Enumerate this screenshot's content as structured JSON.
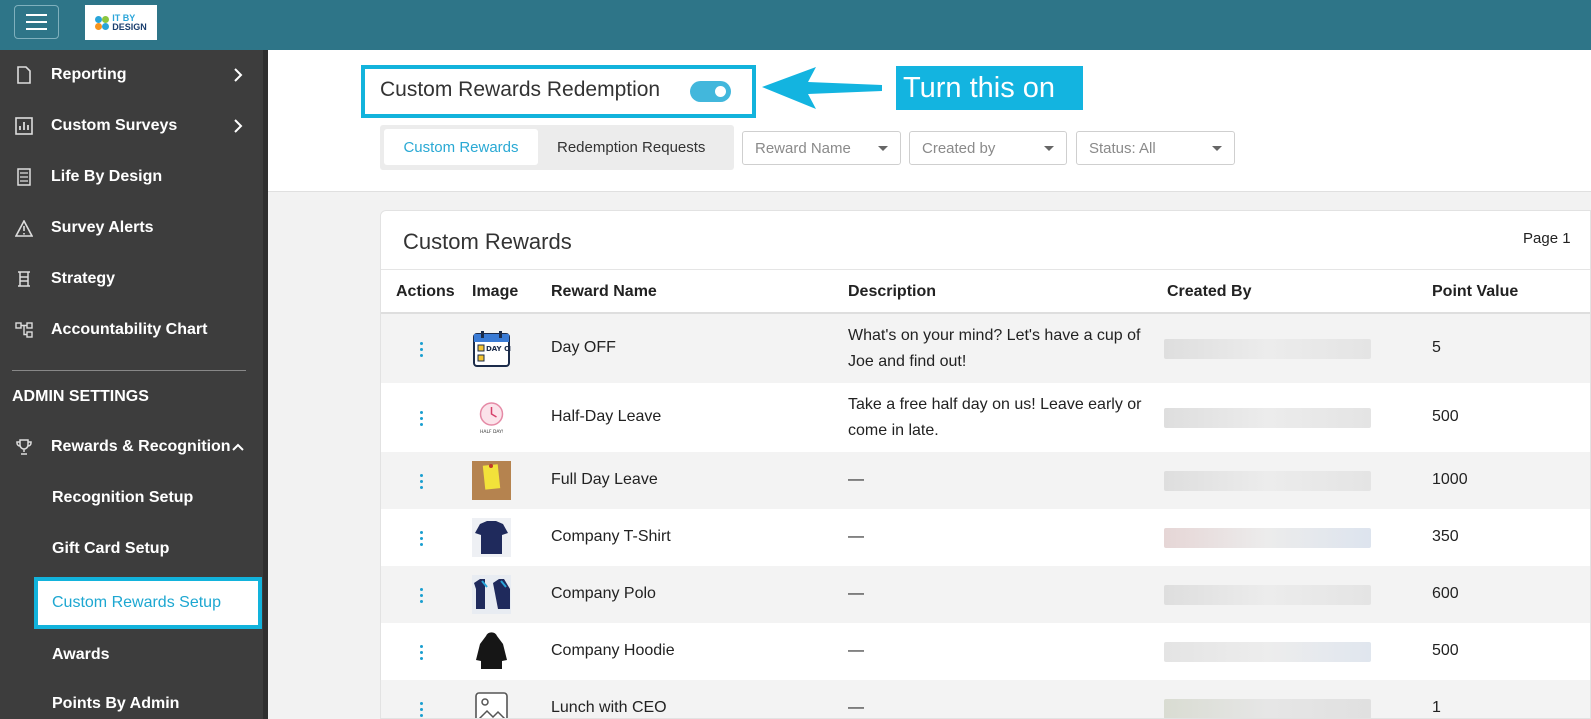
{
  "topbar": {
    "logo_line1": "IT BY",
    "logo_line2": "DESIGN"
  },
  "sidebar": {
    "items": [
      {
        "label": "Reporting",
        "icon": "report-icon"
      },
      {
        "label": "Custom Surveys",
        "icon": "bar-chart-icon"
      },
      {
        "label": "Life By Design",
        "icon": "list-icon"
      },
      {
        "label": "Survey Alerts",
        "icon": "warning-icon"
      },
      {
        "label": "Strategy",
        "icon": "strategy-icon"
      },
      {
        "label": "Accountability Chart",
        "icon": "org-chart-icon"
      }
    ],
    "admin_title": "ADMIN SETTINGS",
    "rewards_label": "Rewards & Recognition",
    "sub_items": [
      "Recognition Setup",
      "Gift Card Setup",
      "Custom Rewards Setup",
      "Awards",
      "Points By Admin"
    ]
  },
  "header": {
    "toggle_title": "Custom Rewards Redemption",
    "toggle_on": true,
    "callout": "Turn this on",
    "tabs": [
      "Custom Rewards",
      "Redemption Requests"
    ],
    "filters": [
      "Reward Name",
      "Created by",
      "Status: All"
    ]
  },
  "table": {
    "title": "Custom Rewards",
    "page_label": "Page 1",
    "columns": [
      "Actions",
      "Image",
      "Reward Name",
      "Description",
      "Created By",
      "Point Value"
    ],
    "rows": [
      {
        "name": "Day OFF",
        "desc1": "What's on your mind? Let's have a cup of",
        "desc2": "Joe and find out!",
        "points": "5"
      },
      {
        "name": "Half-Day Leave",
        "desc1": "Take a free half day on us! Leave early or",
        "desc2": "come in late.",
        "points": "500"
      },
      {
        "name": "Full Day Leave",
        "desc1": "—",
        "desc2": "",
        "points": "1000"
      },
      {
        "name": "Company T-Shirt",
        "desc1": "—",
        "desc2": "",
        "points": "350"
      },
      {
        "name": "Company Polo",
        "desc1": "—",
        "desc2": "",
        "points": "600"
      },
      {
        "name": "Company Hoodie",
        "desc1": "—",
        "desc2": "",
        "points": "500"
      },
      {
        "name": "Lunch with CEO",
        "desc1": "—",
        "desc2": "",
        "points": "1"
      }
    ],
    "thumb_day_off_text": "DAY OFF",
    "thumb_half_day_text": "HALF DAY!"
  },
  "colors": {
    "topbar": "#2e7588",
    "sidebar": "#3d3d3d",
    "accent": "#12b3dc"
  }
}
